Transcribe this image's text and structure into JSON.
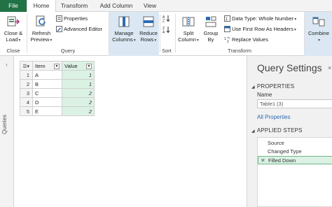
{
  "tabs": {
    "file": "File",
    "home": "Home",
    "transform": "Transform",
    "add_column": "Add Column",
    "view": "View"
  },
  "ribbon": {
    "close_load": [
      "Close &",
      "Load"
    ],
    "close_group": "Close",
    "refresh_preview": [
      "Refresh",
      "Preview"
    ],
    "properties": "Properties",
    "advanced_editor": "Advanced Editor",
    "query_group": "Query",
    "manage_columns": [
      "Manage",
      "Columns"
    ],
    "reduce_rows": [
      "Reduce",
      "Rows"
    ],
    "sort_group": "Sort",
    "split_column": [
      "Split",
      "Column"
    ],
    "group_by": [
      "Group",
      "By"
    ],
    "data_type": "Data Type: Whole Number",
    "use_first_row": "Use First Row As Headers",
    "replace_values": "Replace Values",
    "transform_group": "Transform",
    "combine": "Combine"
  },
  "queries_pane": {
    "label": "Queries",
    "expand": "›"
  },
  "grid": {
    "columns": [
      "Item",
      "Value"
    ],
    "rows": [
      {
        "n": "1",
        "item": "A",
        "value": "1"
      },
      {
        "n": "2",
        "item": "B",
        "value": "1"
      },
      {
        "n": "3",
        "item": "C",
        "value": "2"
      },
      {
        "n": "4",
        "item": "D",
        "value": "2"
      },
      {
        "n": "5",
        "item": "E",
        "value": "2"
      }
    ]
  },
  "query_settings": {
    "title": "Query Settings",
    "close": "×",
    "properties_header": "PROPERTIES",
    "name_label": "Name",
    "name_value": "Table1 (3)",
    "all_properties": "All Properties",
    "applied_steps_header": "APPLIED STEPS",
    "steps": [
      "Source",
      "Changed Type",
      "Filled Down"
    ]
  },
  "colors": {
    "file_tab": "#217346",
    "filled_column": "#dbf1e4",
    "selected_step_border": "#6fb88d",
    "link": "#2b6cb3",
    "ribbon_highlight": "#dbe8f3"
  }
}
